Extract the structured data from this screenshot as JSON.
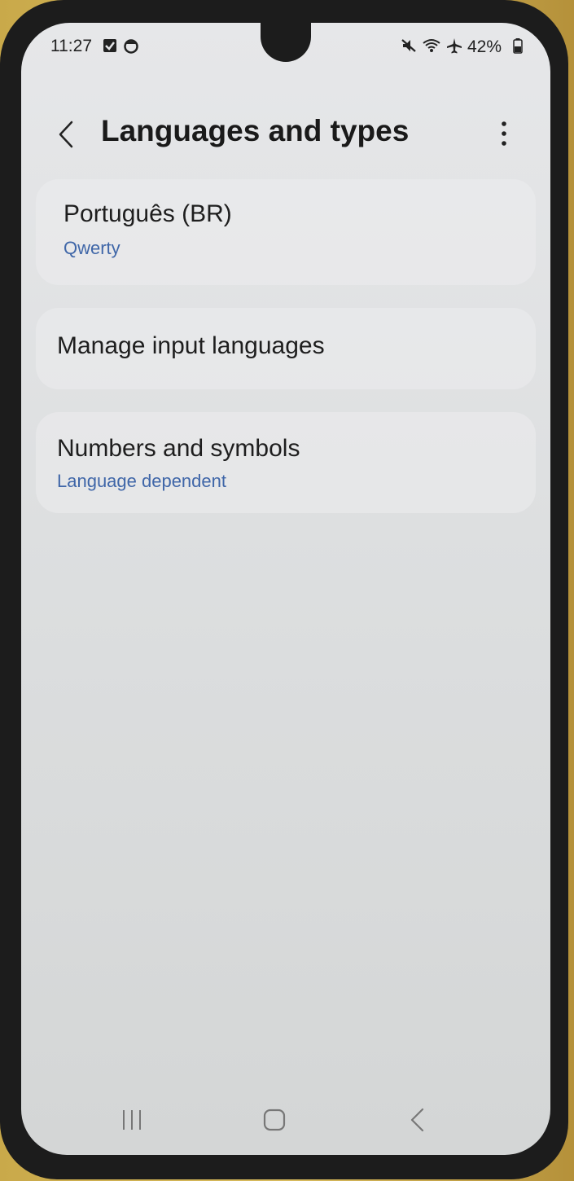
{
  "status_bar": {
    "time": "11:27",
    "battery": "42%",
    "icons": [
      "checkbox-notification-icon",
      "sync-notification-icon",
      "mute-icon",
      "wifi-icon",
      "airplane-icon",
      "battery-icon"
    ]
  },
  "header": {
    "title": "Languages and types",
    "icons": [
      "back-chevron-icon",
      "more-options-icon"
    ]
  },
  "items": [
    {
      "title": "Português (BR)",
      "subtitle": "Qwerty"
    },
    {
      "title": "Manage input languages",
      "subtitle": ""
    },
    {
      "title": "Numbers and symbols",
      "subtitle": "Language dependent"
    }
  ],
  "navbar": {
    "icons": [
      "recent-apps-icon",
      "home-icon",
      "back-icon"
    ]
  },
  "colors": {
    "subtitle_accent": "#3f66a8",
    "screen_background": "#e2e3e5"
  }
}
